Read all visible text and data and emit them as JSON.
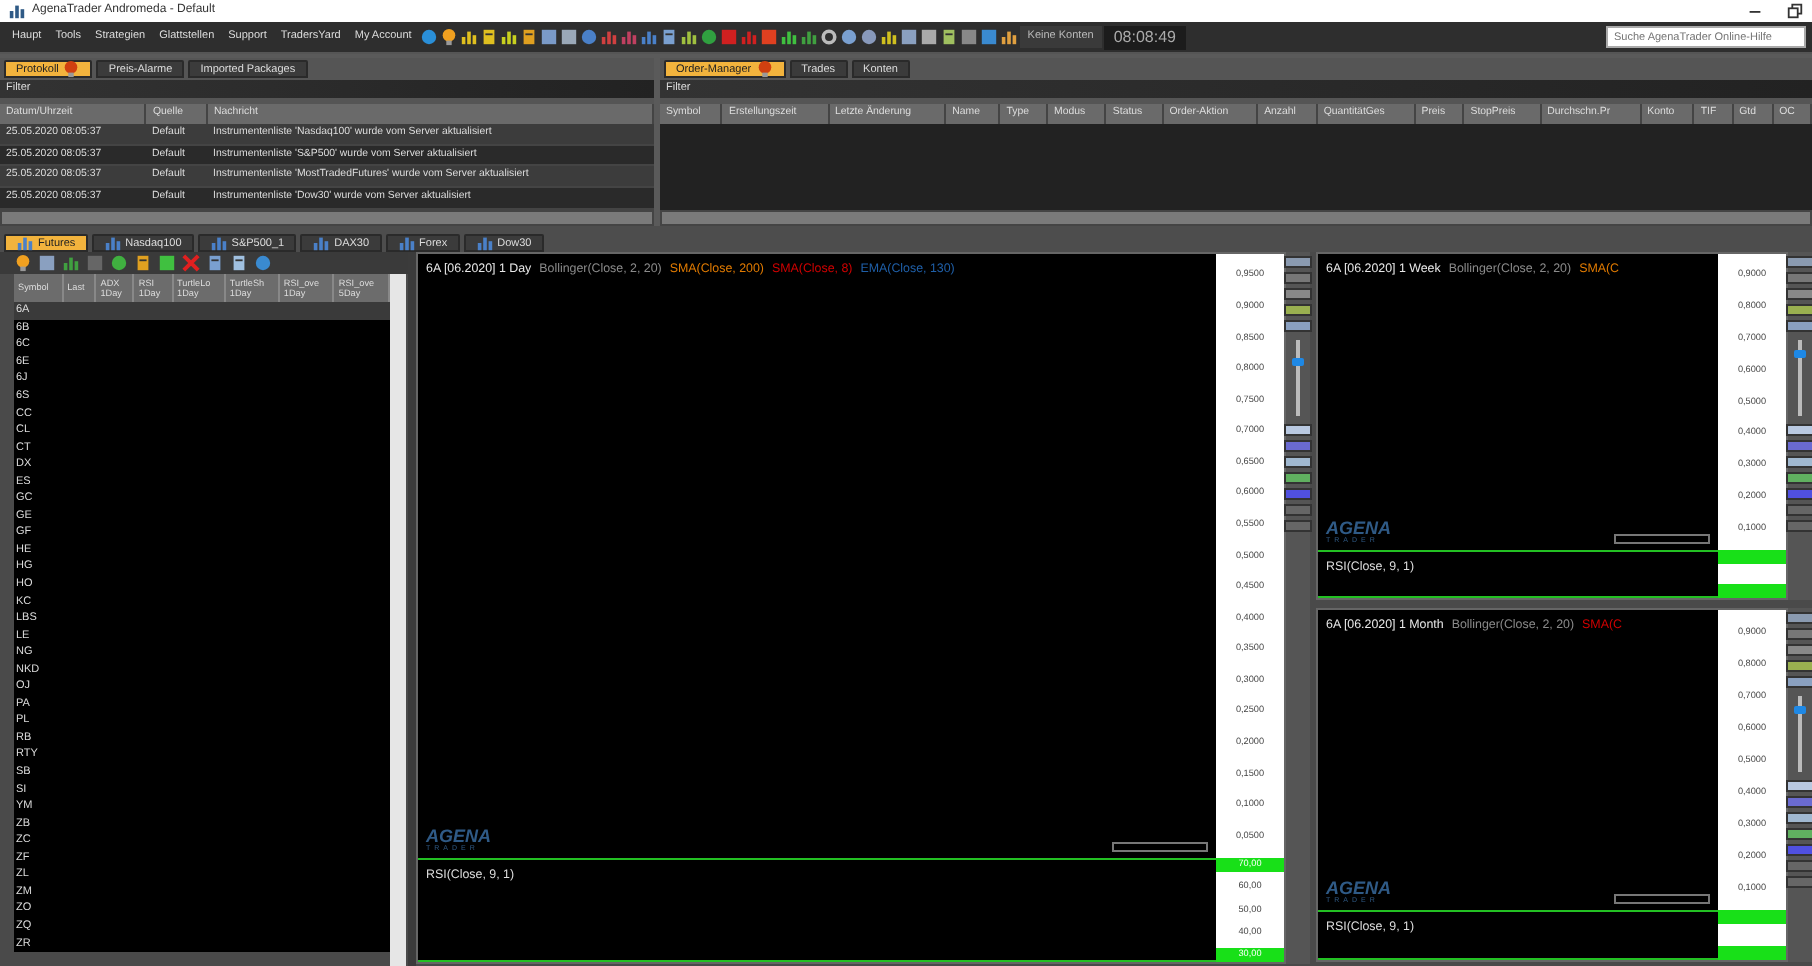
{
  "window": {
    "title": "AgenaTrader Andromeda - Default"
  },
  "menu": [
    "Haupt",
    "Tools",
    "Strategien",
    "Glattstellen",
    "Support",
    "TradersYard",
    "My Account"
  ],
  "account_status": "Keine Konten",
  "clock": "08:08:49",
  "search": {
    "placeholder": "Suche AgenaTrader Online-Hilfe"
  },
  "log_panel": {
    "tabs": [
      {
        "label": "Protokoll",
        "selected": true
      },
      {
        "label": "Preis-Alarme",
        "selected": false
      },
      {
        "label": "Imported Packages",
        "selected": false
      }
    ],
    "filter": "Filter",
    "columns": [
      "Datum/Uhrzeit",
      "Quelle",
      "Nachricht"
    ],
    "rows": [
      [
        "25.05.2020 08:05:37",
        "Default",
        "Instrumentenliste 'Nasdaq100' wurde vom Server aktualisiert"
      ],
      [
        "25.05.2020 08:05:37",
        "Default",
        "Instrumentenliste 'S&P500' wurde vom Server aktualisiert"
      ],
      [
        "25.05.2020 08:05:37",
        "Default",
        "Instrumentenliste 'MostTradedFutures' wurde vom Server aktualisiert"
      ],
      [
        "25.05.2020 08:05:37",
        "Default",
        "Instrumentenliste 'Dow30' wurde vom Server aktualisiert"
      ]
    ]
  },
  "order_panel": {
    "tabs": [
      {
        "label": "Order-Manager",
        "selected": true
      },
      {
        "label": "Trades",
        "selected": false
      },
      {
        "label": "Konten",
        "selected": false
      }
    ],
    "filter": "Filter",
    "columns": [
      "Symbol",
      "Erstellungszeit",
      "Letzte Änderung",
      "Name",
      "Type",
      "Modus",
      "Status",
      "Order-Aktion",
      "Anzahl",
      "QuantitätGes",
      "Preis",
      "StopPreis",
      "Durchschn.Pr",
      "Konto",
      "TIF",
      "Gtd",
      "OC"
    ]
  },
  "list_tabs": [
    {
      "label": "Futures",
      "selected": true
    },
    {
      "label": "Nasdaq100",
      "selected": false
    },
    {
      "label": "S&P500_1",
      "selected": false
    },
    {
      "label": "DAX30",
      "selected": false
    },
    {
      "label": "Forex",
      "selected": false
    },
    {
      "label": "Dow30",
      "selected": false
    }
  ],
  "watchlist": {
    "columns": [
      {
        "name": "Symbol"
      },
      {
        "name": "Last"
      },
      {
        "name": "ADX",
        "period": "1Day"
      },
      {
        "name": "RSI",
        "period": "1Day"
      },
      {
        "name": "TurtleLo",
        "period": "1Day"
      },
      {
        "name": "TurtleSh",
        "period": "1Day"
      },
      {
        "name": "RSI_ove",
        "period": "1Day"
      },
      {
        "name": "RSI_ove",
        "period": "5Day"
      }
    ],
    "rows": [
      {
        "symbol": "6A",
        "selected": true
      },
      {
        "symbol": "6B",
        "selected": false
      },
      {
        "symbol": "6C",
        "selected": false
      },
      {
        "symbol": "6E",
        "selected": false
      },
      {
        "symbol": "6J",
        "selected": false
      },
      {
        "symbol": "6S",
        "selected": false
      },
      {
        "symbol": "CC",
        "selected": false
      },
      {
        "symbol": "CL",
        "selected": false
      },
      {
        "symbol": "CT",
        "selected": false
      },
      {
        "symbol": "DX",
        "selected": false
      },
      {
        "symbol": "ES",
        "selected": false
      },
      {
        "symbol": "GC",
        "selected": false
      },
      {
        "symbol": "GE",
        "selected": false
      },
      {
        "symbol": "GF",
        "selected": false
      },
      {
        "symbol": "HE",
        "selected": false
      },
      {
        "symbol": "HG",
        "selected": false
      },
      {
        "symbol": "HO",
        "selected": false
      },
      {
        "symbol": "KC",
        "selected": false
      },
      {
        "symbol": "LBS",
        "selected": false
      },
      {
        "symbol": "LE",
        "selected": false
      },
      {
        "symbol": "NG",
        "selected": false
      },
      {
        "symbol": "NKD",
        "selected": false
      },
      {
        "symbol": "OJ",
        "selected": false
      },
      {
        "symbol": "PA",
        "selected": false
      },
      {
        "symbol": "PL",
        "selected": false
      },
      {
        "symbol": "RB",
        "selected": false
      },
      {
        "symbol": "RTY",
        "selected": false
      },
      {
        "symbol": "SB",
        "selected": false
      },
      {
        "symbol": "SI",
        "selected": false
      },
      {
        "symbol": "YM",
        "selected": false
      },
      {
        "symbol": "ZB",
        "selected": false
      },
      {
        "symbol": "ZC",
        "selected": false
      },
      {
        "symbol": "ZF",
        "selected": false
      },
      {
        "symbol": "ZL",
        "selected": false
      },
      {
        "symbol": "ZM",
        "selected": false
      },
      {
        "symbol": "ZO",
        "selected": false
      },
      {
        "symbol": "ZQ",
        "selected": false
      },
      {
        "symbol": "ZR",
        "selected": false
      }
    ]
  },
  "charts": [
    {
      "instrument": "6A [06.2020] 1 Day",
      "indicators": [
        {
          "label": "Bollinger(Close, 2, 20)",
          "color": "#8a8a8a"
        },
        {
          "label": "SMA(Close, 200)",
          "color": "#e07a00"
        },
        {
          "label": "SMA(Close, 8)",
          "color": "#d00000"
        },
        {
          "label": "EMA(Close, 130)",
          "color": "#1f5fa8"
        }
      ],
      "price_axis": [
        "0,9500",
        "0,9000",
        "0,8500",
        "0,8000",
        "0,7500",
        "0,7000",
        "0,6500",
        "0,6000",
        "0,5500",
        "0,5000",
        "0,4500",
        "0,4000",
        "0,3500",
        "0,3000",
        "0,2500",
        "0,2000",
        "0,1500",
        "0,1000",
        "0,0500"
      ],
      "logo": {
        "name": "AGENA",
        "tagline": "TRADER"
      },
      "oscillator": {
        "label": "RSI(Close, 9, 1)",
        "axis": [
          {
            "label": "70,00",
            "kind": "band"
          },
          {
            "label": "60,00",
            "kind": "level"
          },
          {
            "label": "50,00",
            "kind": "level"
          },
          {
            "label": "40,00",
            "kind": "level"
          },
          {
            "label": "30,00",
            "kind": "band"
          }
        ]
      },
      "zoom": {
        "level": 0.75
      }
    },
    {
      "instrument": "6A [06.2020] 1 Week",
      "indicators": [
        {
          "label": "Bollinger(Close, 2, 20)",
          "color": "#8a8a8a"
        },
        {
          "label": "SMA(C",
          "color": "#e07a00"
        }
      ],
      "price_axis": [
        "0,9000",
        "0,8000",
        "0,7000",
        "0,6000",
        "0,5000",
        "0,4000",
        "0,3000",
        "0,2000",
        "0,1000"
      ],
      "logo": {
        "name": "AGENA",
        "tagline": "TRADER"
      },
      "oscillator": {
        "label": "RSI(Close, 9, 1)"
      },
      "zoom": {
        "level": 0.85
      }
    },
    {
      "instrument": "6A [06.2020] 1 Month",
      "indicators": [
        {
          "label": "Bollinger(Close, 2, 20)",
          "color": "#8a8a8a"
        },
        {
          "label": "SMA(C",
          "color": "#d00000"
        }
      ],
      "price_axis": [
        "0,9000",
        "0,8000",
        "0,7000",
        "0,6000",
        "0,5000",
        "0,4000",
        "0,3000",
        "0,2000",
        "0,1000"
      ],
      "logo": {
        "name": "AGENA",
        "tagline": "TRADER"
      },
      "oscillator": {
        "label": "RSI(Close, 9, 1)"
      },
      "zoom": {
        "level": 0.85
      }
    }
  ]
}
